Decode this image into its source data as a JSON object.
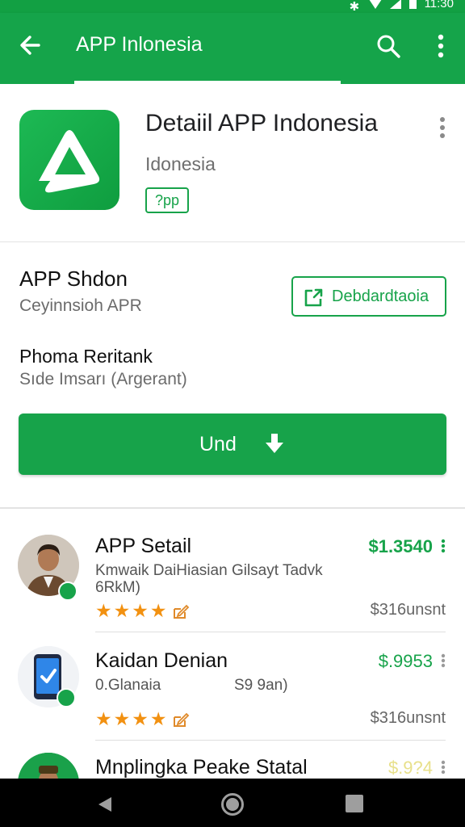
{
  "status_bar": {
    "time": "11:30"
  },
  "app_bar": {
    "title": "APP Inlonesia"
  },
  "app_header": {
    "name": "Detaiil APP Indonesia",
    "developer": "Idonesia",
    "badge": "?pp"
  },
  "details": {
    "section1_title": "APP Shdon",
    "section1_subtitle": "Ceyinnsioh APR",
    "dashboard_button": "Debdardtaoia",
    "section2_title": "Phoma Reritank",
    "section2_subtitle": "Sıde Imsarı (Argerant)",
    "install_button": "Und"
  },
  "list": {
    "items": [
      {
        "title": "APP Setail",
        "description": "Kmwaik DaiHiasian Gilsayt Tadvk 6RkM)",
        "description2": "",
        "price": "$1.3540",
        "meta": "$316unsnt",
        "rating": 4
      },
      {
        "title": "Kaidan Denian",
        "description": "0.Glanaia",
        "description2": "S9 9an)",
        "price": "$.9953",
        "meta": "$316unsnt",
        "rating": 4
      },
      {
        "title": "Mnplingka Peake Statal",
        "description": "",
        "description2": "",
        "price": "$.9?4",
        "meta": "",
        "rating": 0
      }
    ]
  },
  "colors": {
    "primary": "#15a44a",
    "accent_text": "#17a34a",
    "star": "#f29111"
  },
  "icons": {
    "back": "arrow-back-icon",
    "search": "search-icon",
    "more": "more-vert-icon",
    "open": "open-in-new-icon",
    "download": "download-icon",
    "edit": "edit-icon"
  }
}
